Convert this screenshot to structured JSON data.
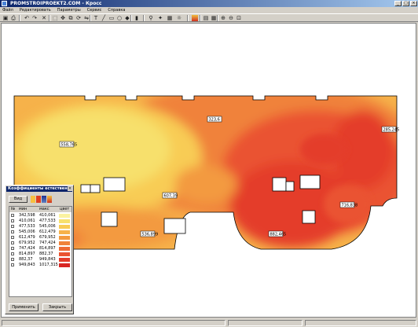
{
  "window": {
    "title": "PROMSTROIPROEKT2.COM - Кросс",
    "minimize": "_",
    "maximize": "□",
    "close": "×"
  },
  "menu": [
    "Файл",
    "Редактировать",
    "Параметры",
    "Сервис",
    "Справка"
  ],
  "toolbar_icons": [
    "save-icon",
    "print-icon",
    "undo-icon",
    "redo-icon",
    "delete-icon",
    "select-icon",
    "move-icon",
    "copy-icon",
    "rotate-icon",
    "mirror-icon",
    "text-icon",
    "line-icon",
    "rect-icon",
    "circle-icon",
    "node-icon",
    "column-icon",
    "pin-icon",
    "lamp-icon",
    "zone-icon",
    "sun-icon",
    "color-map-icon",
    "layers-icon",
    "grid-icon",
    "zoom-in-icon",
    "zoom-out-icon",
    "zoom-fit-icon"
  ],
  "plan_labels": [
    "323,6",
    "285,245",
    "558,765",
    "607,39",
    "716,838",
    "536,899",
    "882,465"
  ],
  "legend": {
    "title": "Коэффициенты естественного освещения",
    "btn": "Вид",
    "headers": [
      "№",
      "мин",
      "макс",
      "цвет"
    ],
    "rows": [
      {
        "min": "342,598",
        "max": "410,061",
        "color": "#fbf2a0"
      },
      {
        "min": "410,061",
        "max": "477,533",
        "color": "#f7e06c"
      },
      {
        "min": "477,533",
        "max": "545,006",
        "color": "#f8cc55"
      },
      {
        "min": "545,006",
        "max": "612,479",
        "color": "#f6b24a"
      },
      {
        "min": "612,479",
        "max": "679,952",
        "color": "#f39a3f"
      },
      {
        "min": "679,952",
        "max": "747,424",
        "color": "#f0823a"
      },
      {
        "min": "747,424",
        "max": "814,897",
        "color": "#ee6a34"
      },
      {
        "min": "814,897",
        "max": "882,37",
        "color": "#ea5230"
      },
      {
        "min": "882,37",
        "max": "949,843",
        "color": "#e43c2a"
      },
      {
        "min": "949,843",
        "max": "1017,315",
        "color": "#d82623"
      }
    ],
    "apply": "Применить",
    "close": "Закрыть"
  }
}
